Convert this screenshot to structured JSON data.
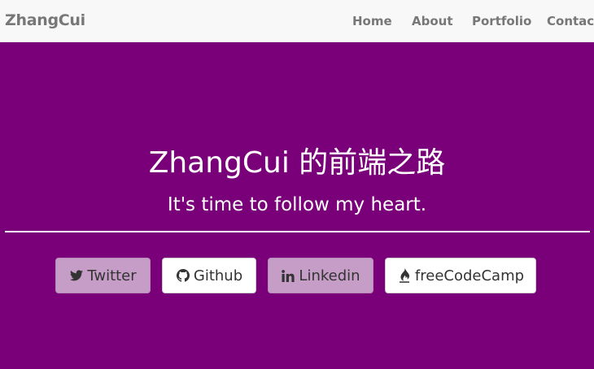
{
  "navbar": {
    "brand": "ZhangCui",
    "links": [
      {
        "label": "Home"
      },
      {
        "label": "About"
      },
      {
        "label": "Portfolio"
      },
      {
        "label": "Contact"
      }
    ]
  },
  "hero": {
    "title": "ZhangCui 的前端之路",
    "subtitle": "It's time to follow my heart.",
    "background_color": "#790079",
    "buttons": [
      {
        "label": "Twitter",
        "icon": "twitter-icon",
        "style": "light-purple"
      },
      {
        "label": "Github",
        "icon": "github-icon",
        "style": "white"
      },
      {
        "label": "Linkedin",
        "icon": "linkedin-icon",
        "style": "light-purple"
      },
      {
        "label": "freeCodeCamp",
        "icon": "fire-icon",
        "style": "white"
      }
    ]
  },
  "colors": {
    "navbar_bg": "#f8f8f8",
    "nav_text": "#777777",
    "hero_bg": "#790079",
    "button_light_purple": "#c59dc6",
    "button_white": "#ffffff"
  }
}
